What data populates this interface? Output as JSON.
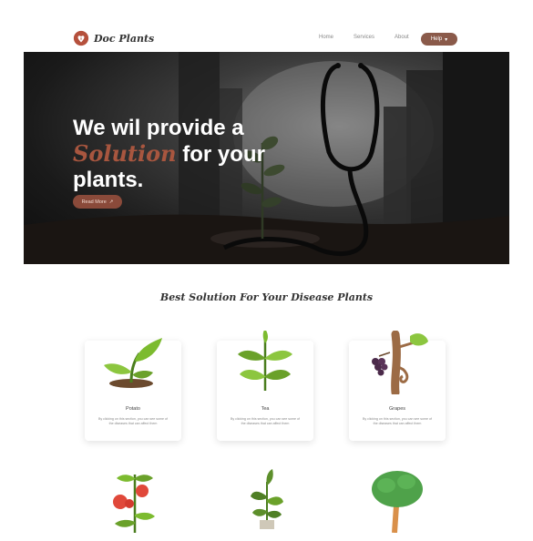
{
  "nav": {
    "brand": "Doc Plants",
    "links": [
      "Home",
      "Services",
      "About"
    ],
    "button_label": "Help"
  },
  "hero": {
    "title_line1": "We wil provide a",
    "title_accent": "Solution",
    "title_line2_rest": " for your",
    "title_line3": "plants.",
    "button_label": "Read More"
  },
  "section": {
    "title": "Best Solution For Your Disease Plants",
    "cards": [
      {
        "name": "Potato",
        "desc": "By clicking on this section, you can see some of the diseases that can affect them"
      },
      {
        "name": "Tea",
        "desc": "By clicking on this section, you can see some of the diseases that can affect them"
      },
      {
        "name": "Grapes",
        "desc": "By clicking on this section, you can see some of the diseases that can affect them"
      }
    ]
  },
  "colors": {
    "accent": "#8a5a4a",
    "hero_accent": "#a8563f"
  }
}
